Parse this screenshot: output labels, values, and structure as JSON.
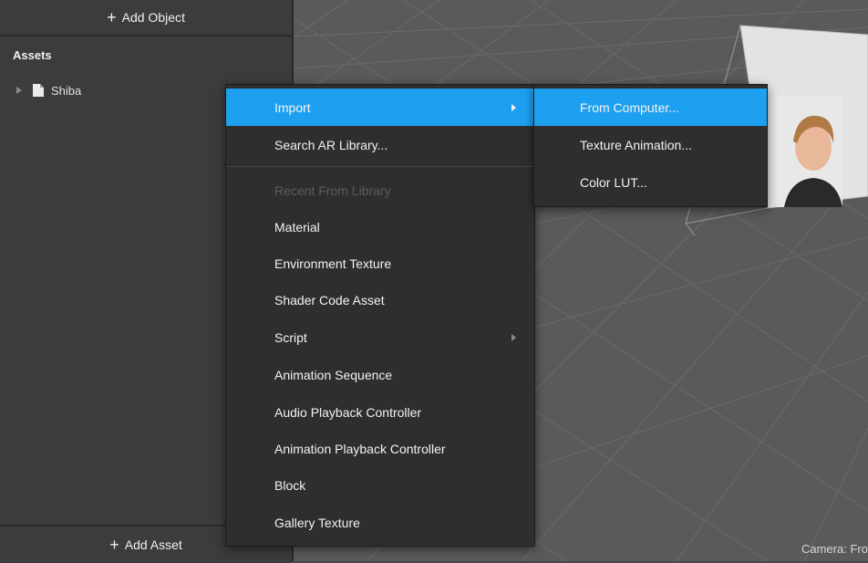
{
  "left_panel": {
    "add_object_label": "Add Object",
    "assets_header": "Assets",
    "asset_items": [
      {
        "label": "Shiba"
      }
    ],
    "add_asset_label": "Add Asset"
  },
  "viewport": {
    "camera_label": "Camera: Fro"
  },
  "context_menu": {
    "items": [
      {
        "label": "Import",
        "state": "active",
        "has_submenu": true
      },
      {
        "label": "Search AR Library...",
        "state": "normal"
      },
      {
        "label": "Recent From Library",
        "state": "disabled"
      },
      {
        "label": "Material",
        "state": "normal"
      },
      {
        "label": "Environment Texture",
        "state": "normal"
      },
      {
        "label": "Shader Code Asset",
        "state": "normal"
      },
      {
        "label": "Script",
        "state": "normal",
        "has_submenu": true
      },
      {
        "label": "Animation Sequence",
        "state": "normal"
      },
      {
        "label": "Audio Playback Controller",
        "state": "normal"
      },
      {
        "label": "Animation Playback Controller",
        "state": "normal"
      },
      {
        "label": "Block",
        "state": "normal"
      },
      {
        "label": "Gallery Texture",
        "state": "normal"
      }
    ]
  },
  "import_submenu": {
    "items": [
      {
        "label": "From Computer...",
        "state": "active"
      },
      {
        "label": "Texture Animation...",
        "state": "normal"
      },
      {
        "label": "Color LUT...",
        "state": "normal"
      }
    ]
  },
  "colors": {
    "accent": "#1ea0f0",
    "panel_bg": "#3c3c3c",
    "menu_bg": "#2e2e2e",
    "viewport_bg": "#5a5a5a"
  }
}
